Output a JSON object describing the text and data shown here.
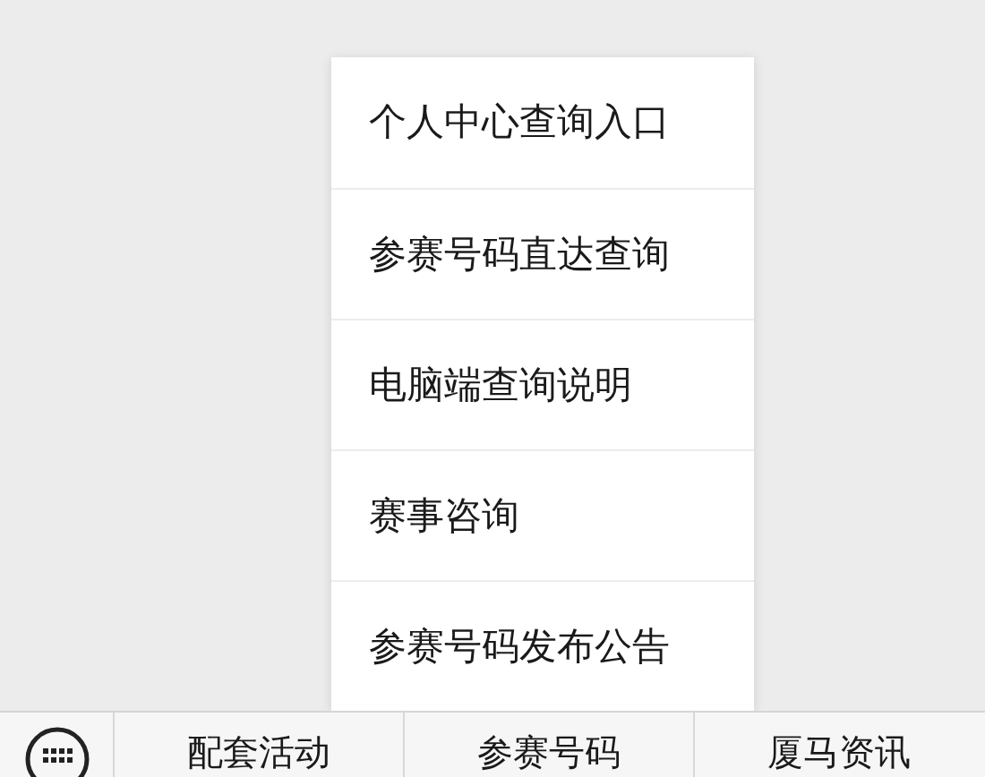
{
  "menu": {
    "items": [
      {
        "label": "个人中心查询入口"
      },
      {
        "label": "参赛号码直达查询"
      },
      {
        "label": "电脑端查询说明"
      },
      {
        "label": "赛事咨询"
      },
      {
        "label": "参赛号码发布公告"
      }
    ]
  },
  "bottom_bar": {
    "tabs": [
      {
        "label": "配套活动"
      },
      {
        "label": "参赛号码"
      },
      {
        "label": "厦马资讯"
      }
    ]
  }
}
